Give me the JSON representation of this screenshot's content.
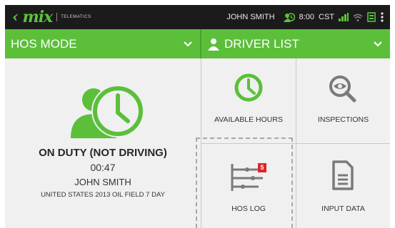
{
  "statusbar": {
    "logo_mark": "‹ mix",
    "logo_sub": "TELEMATICS",
    "user": "JOHN SMITH",
    "time": "8:00",
    "timezone": "CST"
  },
  "hos_header": {
    "title": "HOS MODE"
  },
  "driver_header": {
    "title": "DRIVER LIST"
  },
  "status": {
    "title": "ON DUTY (NOT DRIVING)",
    "elapsed": "00:47",
    "driver": "JOHN SMITH",
    "ruleset": "UNITED STATES 2013 OIL FIELD 7 DAY"
  },
  "tiles": {
    "available_hours": "AVAILABLE HOURS",
    "inspections": "INSPECTIONS",
    "hos_log": "HOS LOG",
    "hos_log_badge": "5",
    "input_data": "INPUT DATA"
  },
  "colors": {
    "accent": "#5bbf3a",
    "statusbar": "#1b1b1b",
    "badge": "#e02424",
    "tile_bg": "#f0f0f0"
  },
  "icons": [
    "mix-logo",
    "driver-clock-icon",
    "signal-icon",
    "wifi-icon",
    "battery-icon",
    "more-icon",
    "chevron-down-icon",
    "person-icon",
    "clock-icon",
    "eye-search-icon",
    "hos-log-icon",
    "document-icon"
  ]
}
